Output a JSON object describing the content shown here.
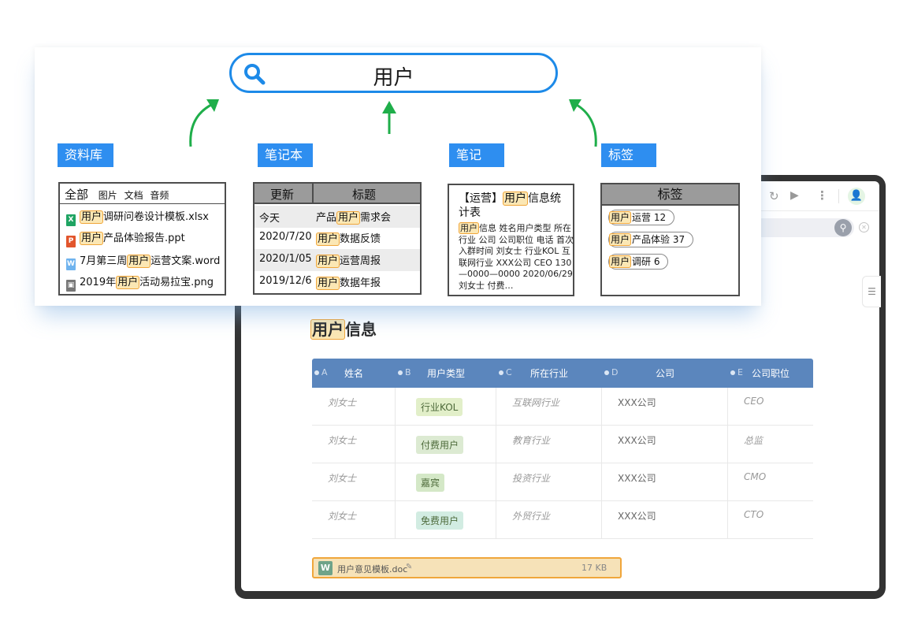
{
  "search": {
    "query": "用户"
  },
  "labels": {
    "library": "资料库",
    "notebook": "笔记本",
    "note": "笔记",
    "tags": "标签"
  },
  "library": {
    "tab_all": "全部",
    "tab_images": "图片",
    "tab_docs": "文档",
    "tab_audio": "音频",
    "files": [
      {
        "pre": "",
        "hl": "用户",
        "post": "调研问卷设计模板.xlsx",
        "type": "X",
        "color": "#1fa463"
      },
      {
        "pre": "",
        "hl": "用户",
        "post": "产品体验报告.ppt",
        "type": "P",
        "color": "#e2552c"
      },
      {
        "pre": "7月第三周",
        "hl": "用户",
        "post": "运营文案.word",
        "type": "W",
        "color": "#6fb3ee"
      },
      {
        "pre": "2019年",
        "hl": "用户",
        "post": "活动易拉宝.png",
        "type": "▣",
        "color": "#777777"
      }
    ]
  },
  "notebook": {
    "col_updated": "更新",
    "col_title": "标题",
    "rows": [
      {
        "date": "今天",
        "pre": "产品",
        "hl": "用户",
        "post": "需求会"
      },
      {
        "date": "2020/7/20",
        "pre": "",
        "hl": "用户",
        "post": "数据反馈"
      },
      {
        "date": "2020/1/05",
        "pre": "",
        "hl": "用户",
        "post": "运营周报"
      },
      {
        "date": "2019/12/6",
        "pre": "",
        "hl": "用户",
        "post": "数据年报"
      }
    ]
  },
  "note": {
    "title_pre": "【运营】",
    "title_hl": "用户",
    "title_post": "信息统计表",
    "body_hl": "用户",
    "body": "信息 姓名用户类型 所在行业 公司 公司职位 电话 首次入群时间 刘女士 行业KOL 互联网行业 XXX公司 CEO 130—0000—0000 2020/06/29 刘女士 付费…"
  },
  "tags": {
    "header": "标签",
    "items": [
      {
        "hl": "用户",
        "post": "运营 12"
      },
      {
        "hl": "用户",
        "post": "产品体验 37"
      },
      {
        "hl": "用户",
        "post": "调研 6"
      }
    ]
  },
  "doc": {
    "title_hl": "用户",
    "title_post": "信息",
    "columns": [
      {
        "letter": "A",
        "name": "姓名"
      },
      {
        "letter": "B",
        "name": "用户类型"
      },
      {
        "letter": "C",
        "name": "所在行业"
      },
      {
        "letter": "D",
        "name": "公司"
      },
      {
        "letter": "E",
        "name": "公司职位"
      }
    ],
    "rows": [
      {
        "name": "刘女士",
        "type": "行业KOL",
        "type_bg": "#e2efc9",
        "industry": "互联网行业",
        "company": "XXX公司",
        "position": "CEO"
      },
      {
        "name": "刘女士",
        "type": "付费用户",
        "type_bg": "#dcead2",
        "industry": "教育行业",
        "company": "XXX公司",
        "position": "总监"
      },
      {
        "name": "刘女士",
        "type": "嘉宾",
        "type_bg": "#d4e8c7",
        "industry": "投资行业",
        "company": "XXX公司",
        "position": "CMO"
      },
      {
        "name": "刘女士",
        "type": "免费用户",
        "type_bg": "#d2ece2",
        "industry": "外贸行业",
        "company": "XXX公司",
        "position": "CTO"
      }
    ],
    "attachment": {
      "name": "用户意见模板.doc",
      "size": "17 KB"
    }
  },
  "colors": {
    "accent": "#1d8ae8",
    "label_bg": "#2e8ef0",
    "highlight": "#fbe7b4",
    "highlight_border": "#f0a63b",
    "arrow": "#1fae4a",
    "table_header": "#5b86bd"
  }
}
